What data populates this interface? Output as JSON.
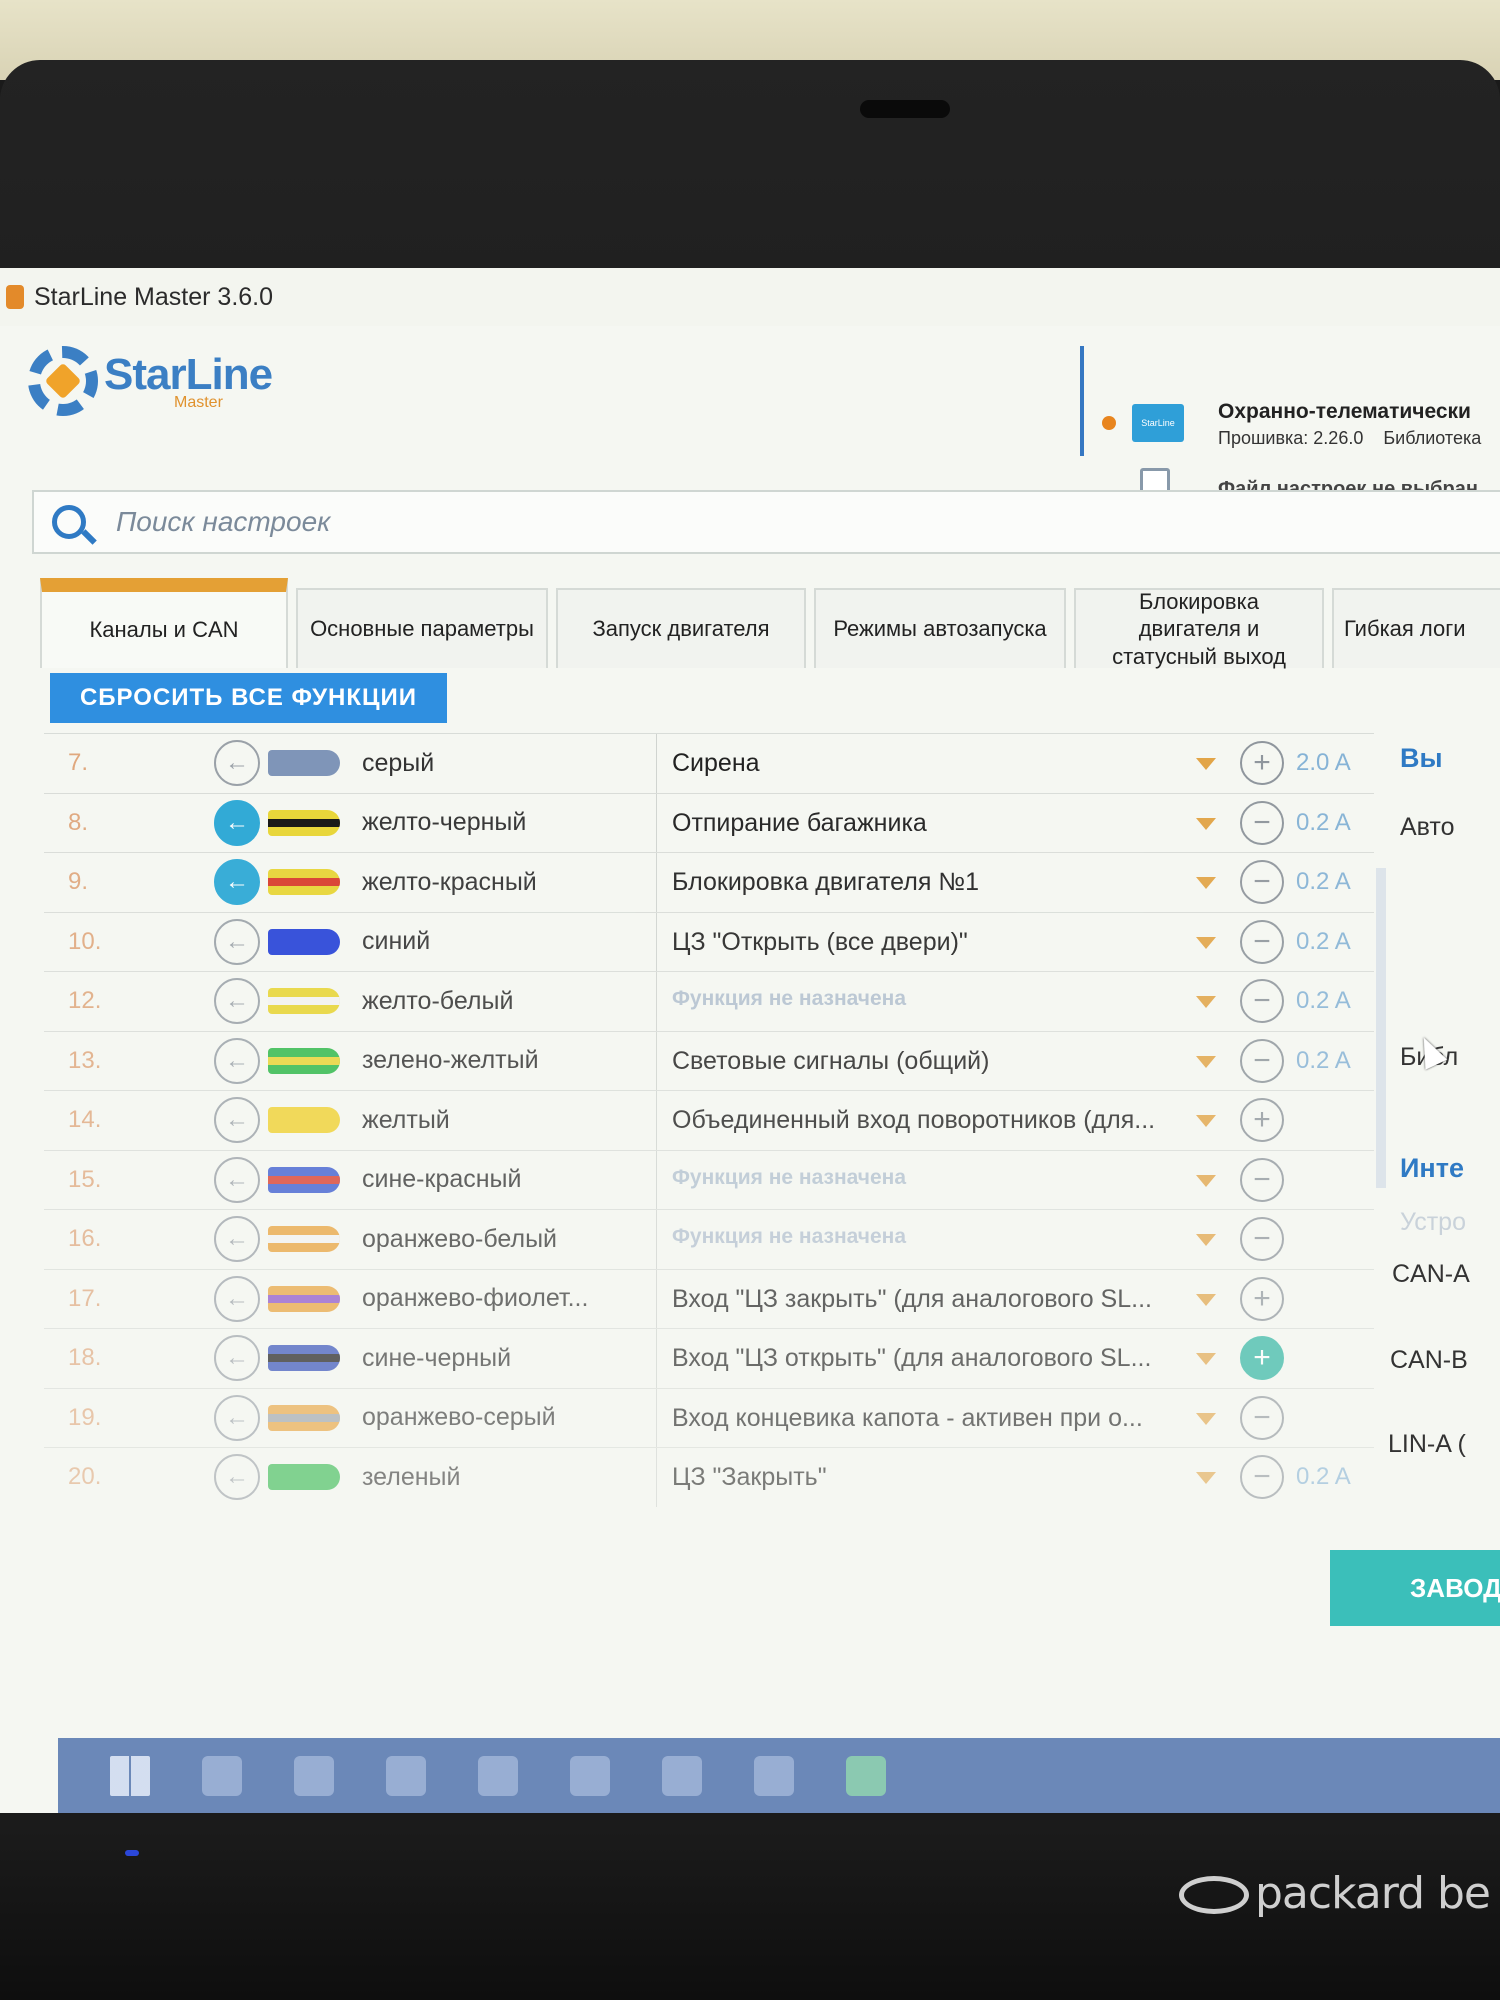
{
  "window": {
    "title": "StarLine Master 3.6.0"
  },
  "header": {
    "logo_name": "StarLine",
    "logo_sub": "Master",
    "device_title": "Охранно-телематически",
    "firmware": "Прошивка: 2.26.0",
    "library": "Библиотека",
    "file_status": "Файл настроек не выбран"
  },
  "search": {
    "placeholder": "Поиск настроек"
  },
  "tabs": [
    {
      "label": "Каналы и CAN",
      "active": true
    },
    {
      "label": "Основные параметры"
    },
    {
      "label": "Запуск двигателя"
    },
    {
      "label": "Режимы автозапуска"
    },
    {
      "label": "Блокировка двигателя и статусный выход"
    },
    {
      "label": "Гибкая логи"
    }
  ],
  "reset_button": "СБРОСИТЬ ВСЕ ФУНКЦИИ",
  "channels": [
    {
      "num": "7.",
      "dir_on": false,
      "wire_color": "#7f95b8",
      "stripe_color": "",
      "color": "серый",
      "function": "Сирена",
      "assigned": true,
      "pm": "+",
      "pm_on": false,
      "current": "2.0 A"
    },
    {
      "num": "8.",
      "dir_on": true,
      "wire_color": "#e8d534",
      "stripe_color": "#111111",
      "color": "желто-черный",
      "function": "Отпирание багажника",
      "assigned": true,
      "pm": "−",
      "pm_on": false,
      "current": "0.2 A"
    },
    {
      "num": "9.",
      "dir_on": true,
      "wire_color": "#e8d534",
      "stripe_color": "#d93a2a",
      "color": "желто-красный",
      "function": "Блокировка двигателя №1",
      "assigned": true,
      "pm": "−",
      "pm_on": false,
      "current": "0.2 A"
    },
    {
      "num": "10.",
      "dir_on": false,
      "wire_color": "#2340d8",
      "stripe_color": "",
      "color": "синий",
      "function": "ЦЗ \"Открыть (все двери)\"",
      "assigned": true,
      "pm": "−",
      "pm_on": false,
      "current": "0.2 A"
    },
    {
      "num": "12.",
      "dir_on": false,
      "wire_color": "#e8d534",
      "stripe_color": "#f3f3f3",
      "color": "желто-белый",
      "function": "Функция не назначена",
      "assigned": false,
      "pm": "−",
      "pm_on": false,
      "current": "0.2 A"
    },
    {
      "num": "13.",
      "dir_on": false,
      "wire_color": "#2fb84a",
      "stripe_color": "#e8d534",
      "color": "зелено-желтый",
      "function": "Световые сигналы (общий)",
      "assigned": true,
      "pm": "−",
      "pm_on": false,
      "current": "0.2 A"
    },
    {
      "num": "14.",
      "dir_on": false,
      "wire_color": "#f0d232",
      "stripe_color": "",
      "color": "желтый",
      "function": "Объединенный вход поворотников (для...",
      "assigned": true,
      "pm": "+",
      "pm_on": false,
      "current": ""
    },
    {
      "num": "15.",
      "dir_on": false,
      "wire_color": "#3a5bd0",
      "stripe_color": "#d93a2a",
      "color": "сине-красный",
      "function": "Функция не назначена",
      "assigned": false,
      "pm": "−",
      "pm_on": false,
      "current": ""
    },
    {
      "num": "16.",
      "dir_on": false,
      "wire_color": "#e9a23a",
      "stripe_color": "#f3f3f3",
      "color": "оранжево-белый",
      "function": "Функция не назначена",
      "assigned": false,
      "pm": "−",
      "pm_on": false,
      "current": ""
    },
    {
      "num": "17.",
      "dir_on": false,
      "wire_color": "#e9a23a",
      "stripe_color": "#8a4fc8",
      "color": "оранжево-фиолет...",
      "function": "Вход \"ЦЗ закрыть\" (для аналогового SL...",
      "assigned": true,
      "pm": "+",
      "pm_on": false,
      "current": ""
    },
    {
      "num": "18.",
      "dir_on": false,
      "wire_color": "#2e4ab8",
      "stripe_color": "#111111",
      "color": "сине-черный",
      "function": "Вход \"ЦЗ открыть\" (для аналогового SL...",
      "assigned": true,
      "pm": "+",
      "pm_on": true,
      "current": ""
    },
    {
      "num": "19.",
      "dir_on": false,
      "wire_color": "#e9a23a",
      "stripe_color": "#9aa1a8",
      "color": "оранжево-серый",
      "function": "Вход концевика капота - активен при о...",
      "assigned": true,
      "pm": "−",
      "pm_on": false,
      "current": ""
    },
    {
      "num": "20.",
      "dir_on": false,
      "wire_color": "#2fb84a",
      "stripe_color": "",
      "color": "зеленый",
      "function": "ЦЗ \"Закрыть\"",
      "assigned": true,
      "pm": "−",
      "pm_on": false,
      "current": "0.2 A"
    }
  ],
  "right_panel": {
    "out_head": "Вы",
    "auto": "Авто",
    "lib": "Библ",
    "inter_head": "Инте",
    "device": "Устро",
    "can_a": "CAN-A",
    "can_b": "CAN-B",
    "lin_a": "LIN-A ("
  },
  "write_button": "ЗАВОД",
  "laptop_brand": "packard be"
}
